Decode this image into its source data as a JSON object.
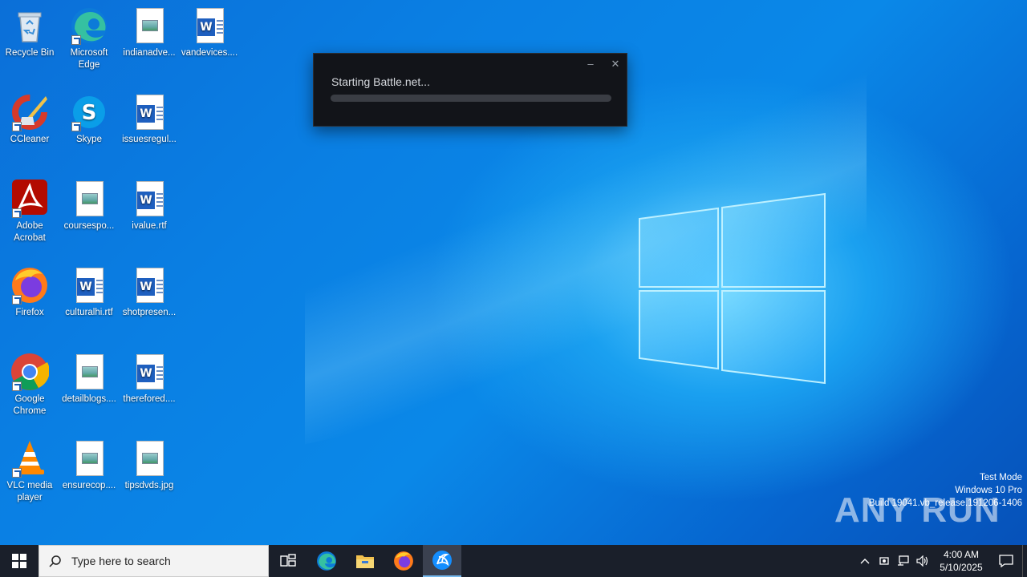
{
  "desktop_icons": [
    {
      "label": "Recycle Bin",
      "type": "recycle"
    },
    {
      "label": "Microsoft Edge",
      "type": "edge"
    },
    {
      "label": "indianadve...",
      "type": "image-doc"
    },
    {
      "label": "vandevices....",
      "type": "word-doc"
    },
    {
      "label": "CCleaner",
      "type": "ccleaner"
    },
    {
      "label": "Skype",
      "type": "skype"
    },
    {
      "label": "issuesregul...",
      "type": "word-doc"
    },
    {
      "label": "Adobe Acrobat",
      "type": "acrobat"
    },
    {
      "label": "coursespo...",
      "type": "image-doc"
    },
    {
      "label": "ivalue.rtf",
      "type": "word-doc"
    },
    {
      "label": "Firefox",
      "type": "firefox"
    },
    {
      "label": "culturalhi.rtf",
      "type": "word-doc"
    },
    {
      "label": "shotpresen...",
      "type": "word-doc"
    },
    {
      "label": "Google Chrome",
      "type": "chrome"
    },
    {
      "label": "detailblogs....",
      "type": "image-doc"
    },
    {
      "label": "therefored....",
      "type": "word-doc"
    },
    {
      "label": "VLC media player",
      "type": "vlc"
    },
    {
      "label": "ensurecop....",
      "type": "image-doc"
    },
    {
      "label": "tipsdvds.jpg",
      "type": "image-doc"
    }
  ],
  "battlenet_window": {
    "status_text": "Starting Battle.net...",
    "minimize_icon": "–",
    "close_icon": "✕",
    "progress": 0
  },
  "watermark": {
    "brand": "ANY RUN",
    "line1": "Test Mode",
    "line2": "Windows 10 Pro",
    "line3": "Build 19041.vb_release.191206-1406"
  },
  "taskbar": {
    "search_placeholder": "Type here to search",
    "apps": [
      "task-view",
      "edge",
      "file-explorer",
      "firefox",
      "battlenet"
    ],
    "clock_time": "4:00 AM",
    "clock_date": "5/10/2025"
  }
}
